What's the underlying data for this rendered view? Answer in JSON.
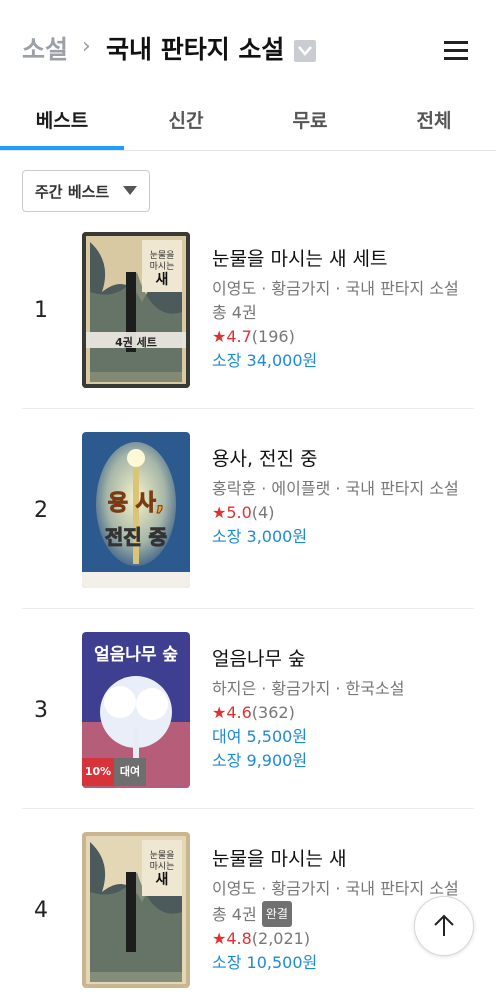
{
  "header": {
    "breadcrumb_root": "소설",
    "breadcrumb_separator": "›",
    "breadcrumb_current": "국내 판타지 소설"
  },
  "tabs": [
    {
      "label": "베스트",
      "active": true
    },
    {
      "label": "신간",
      "active": false
    },
    {
      "label": "무료",
      "active": false
    },
    {
      "label": "전체",
      "active": false
    }
  ],
  "filter": {
    "label": "주간 베스트"
  },
  "items": [
    {
      "rank": "1",
      "title": "눈물을 마시는 새 세트",
      "meta": "이영도 · 황금가지 · 국내 판타지 소설",
      "count": "총 4권",
      "rating_score": "4.7",
      "rating_count": "(196)",
      "prices": [
        "소장 34,000원"
      ],
      "cover_label": "4권 세트"
    },
    {
      "rank": "2",
      "title": "용사, 전진 중",
      "meta": "홍락훈 · 에이플랫 · 국내 판타지 소설",
      "rating_score": "5.0",
      "rating_count": "(4)",
      "prices": [
        "소장 3,000원"
      ],
      "cover_text": "용사, 전진 중"
    },
    {
      "rank": "3",
      "title": "얼음나무 숲",
      "meta": "하지은 · 황금가지 · 한국소설",
      "rating_score": "4.6",
      "rating_count": "(362)",
      "prices": [
        "대여 5,500원",
        "소장 9,900원"
      ],
      "cover_text": "얼음나무 숲",
      "discount_badge": "10%",
      "rental_badge": "대여"
    },
    {
      "rank": "4",
      "title": "눈물을 마시는 새",
      "meta": "이영도 · 황금가지 · 국내 판타지 소설",
      "count": "총 4권",
      "complete_badge": "완결",
      "rating_score": "4.8",
      "rating_count": "(2,021)",
      "prices": [
        "소장 10,500원"
      ]
    }
  ],
  "icons": {
    "star": "★",
    "menu": "hamburger-icon",
    "scroll_top": "arrow-up-icon"
  },
  "colors": {
    "accent": "#1e9eff",
    "price": "#1c8ad8",
    "star": "#e03131"
  }
}
